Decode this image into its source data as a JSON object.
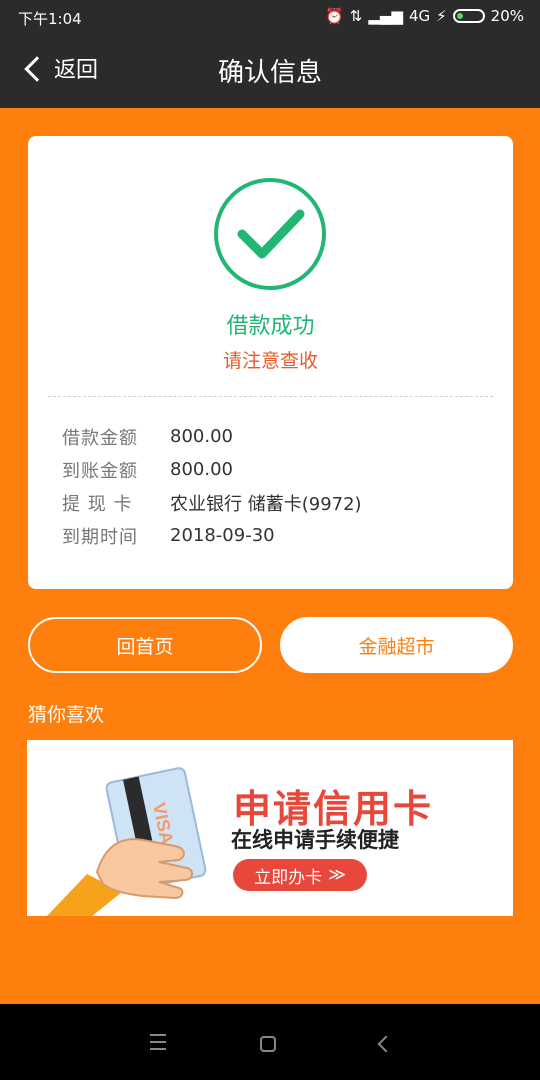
{
  "status_bar": {
    "time": "下午1:04",
    "network": "4G",
    "battery": "20%"
  },
  "header": {
    "back_label": "返回",
    "title": "确认信息"
  },
  "result": {
    "status": "借款成功",
    "notice": "请注意查收",
    "details": [
      {
        "label": "借款金额",
        "value": "800.00"
      },
      {
        "label": "到账金额",
        "value": "800.00"
      },
      {
        "label": "提 现 卡",
        "value": "农业银行 储蓄卡(9972)"
      },
      {
        "label": "到期时间",
        "value": "2018-09-30"
      }
    ]
  },
  "actions": {
    "home_label": "回首页",
    "market_label": "金融超市"
  },
  "recommend": {
    "title": "猜你喜欢",
    "banner": {
      "title": "申请信用卡",
      "subtitle": "在线申请手续便捷",
      "button": "立即办卡",
      "button_arrow": "≫",
      "card_brand": "VISA"
    }
  },
  "colors": {
    "accent": "#ff7f0e",
    "success": "#22b573",
    "notice": "#e85c2c",
    "banner_red": "#e8473b"
  }
}
